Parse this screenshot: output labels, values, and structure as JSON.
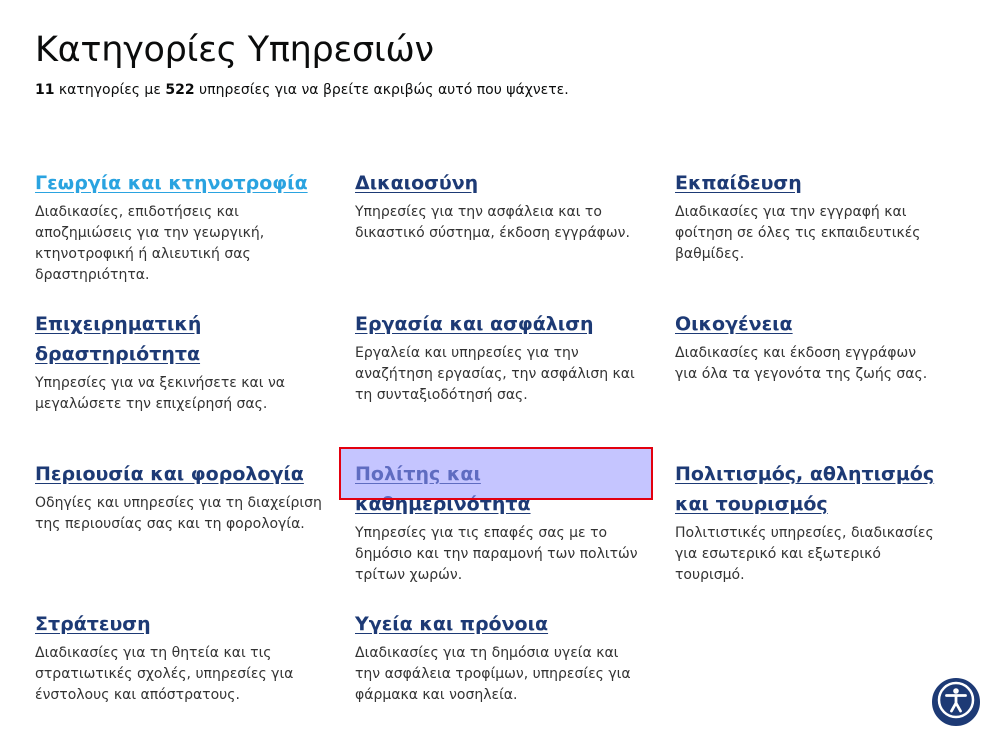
{
  "page": {
    "title": "Κατηγορίες Υπηρεσιών",
    "summary": {
      "category_count": "11",
      "text_1": " κατηγορίες με ",
      "service_count": "522",
      "text_2": " υπηρεσίες για να βρείτε ακριβώς αυτό που ψάχνετε."
    }
  },
  "categories": [
    {
      "title": "Γεωργία και κτηνοτροφία",
      "description": "Διαδικασίες, επιδοτήσεις και αποζημιώσεις για την γεωργική, κτηνοτροφική ή αλιευτική σας δραστηριότητα."
    },
    {
      "title": "Δικαιοσύνη",
      "description": "Υπηρεσίες για την ασφάλεια και το δικαστικό σύστημα, έκδοση εγγράφων."
    },
    {
      "title": "Εκπαίδευση",
      "description": "Διαδικασίες για την εγγραφή και φοίτηση σε όλες τις εκπαιδευτικές βαθμίδες."
    },
    {
      "title": "Επιχειρηματική δραστηριότητα",
      "description": "Υπηρεσίες για να ξεκινήσετε και να μεγαλώσετε την επιχείρησή σας."
    },
    {
      "title": "Εργασία και ασφάλιση",
      "description": "Εργαλεία και υπηρεσίες για την αναζήτηση εργασίας, την ασφάλιση και τη συνταξιοδότησή σας."
    },
    {
      "title": "Οικογένεια",
      "description": "Διαδικασίες και έκδοση εγγράφων για όλα τα γεγονότα της ζωής σας."
    },
    {
      "title": "Περιουσία και φορολογία",
      "description": "Οδηγίες και υπηρεσίες για τη διαχείριση της περιουσίας σας και τη φορολογία."
    },
    {
      "title": "Πολίτης και καθημερινότητα",
      "description": "Υπηρεσίες για τις επαφές σας με το δημόσιο και την παραμονή των πολιτών τρίτων χωρών."
    },
    {
      "title": "Πολιτισμός, αθλητισμός και τουρισμός",
      "description": "Πολιτιστικές υπηρεσίες, διαδικασίες για εσωτερικό και εξωτερικό τουρισμό."
    },
    {
      "title": "Στράτευση",
      "description": "Διαδικασίες για τη θητεία και τις στρατιωτικές σχολές, υπηρεσίες για ένστολους και απόστρατους."
    },
    {
      "title": "Υγεία και πρόνοια",
      "description": "Διαδικασίες για τη δημόσια υγεία και την ασφάλεια τροφίμων, υπηρεσίες για φάρμακα και νοσηλεία."
    }
  ],
  "accessibility_button": {
    "icon": "accessibility-icon"
  },
  "colors": {
    "link": "#1d3a75",
    "link_hover": "#2aa3e0",
    "highlight_border": "#e3000f"
  }
}
